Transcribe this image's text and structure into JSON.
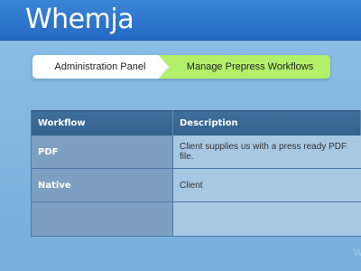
{
  "app": {
    "logo": "Whemja"
  },
  "breadcrumb": {
    "items": [
      {
        "label": "Administration Panel"
      },
      {
        "label": "Manage Prepress Workflows"
      }
    ]
  },
  "table": {
    "headers": [
      "Workflow",
      "Description"
    ],
    "rows": [
      {
        "workflow": "PDF",
        "description": "Client supplies us with a press ready PDF file."
      },
      {
        "workflow": "Native",
        "description": "Client"
      },
      {
        "workflow": "",
        "description": ""
      }
    ]
  },
  "watermark": "W",
  "colors": {
    "header_bar": "#2b6fc7",
    "breadcrumb_active": "#b2f06a",
    "table_header": "#3a6896"
  }
}
